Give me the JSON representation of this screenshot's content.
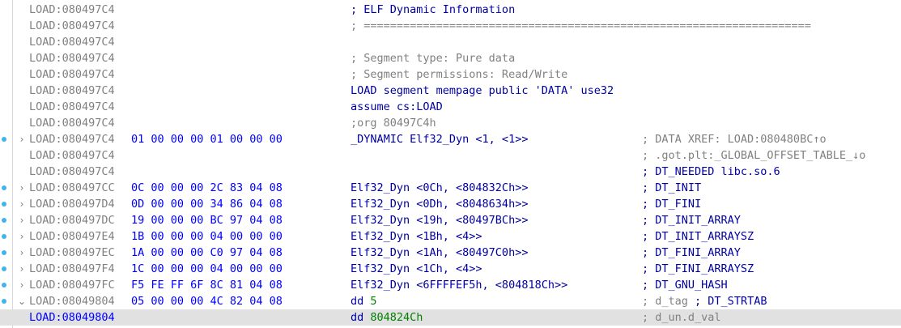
{
  "lines": [
    {
      "addr": "LOAD:080497C4",
      "bytes": "",
      "instr": "; ELF Dynamic Information",
      "instr_style": "blue",
      "comment": "",
      "comment_style": "blue",
      "fold": "",
      "bp": false
    },
    {
      "addr": "LOAD:080497C4",
      "bytes": "",
      "instr": "; ====================================================================",
      "instr_style": "gray",
      "comment": "",
      "comment_style": "blue",
      "fold": "",
      "bp": false
    },
    {
      "addr": "LOAD:080497C4",
      "bytes": "",
      "instr": "",
      "instr_style": "blue",
      "comment": "",
      "comment_style": "blue",
      "fold": "",
      "bp": false
    },
    {
      "addr": "LOAD:080497C4",
      "bytes": "",
      "instr": "; Segment type: Pure data",
      "instr_style": "gray",
      "comment": "",
      "comment_style": "blue",
      "fold": "",
      "bp": false
    },
    {
      "addr": "LOAD:080497C4",
      "bytes": "",
      "instr": "; Segment permissions: Read/Write",
      "instr_style": "gray",
      "comment": "",
      "comment_style": "blue",
      "fold": "",
      "bp": false
    },
    {
      "addr": "LOAD:080497C4",
      "bytes": "",
      "instr": "LOAD segment mempage public 'DATA' use32",
      "instr_style": "blue",
      "comment": "",
      "comment_style": "blue",
      "fold": "",
      "bp": false
    },
    {
      "addr": "LOAD:080497C4",
      "bytes": "",
      "instr": "assume cs:LOAD",
      "instr_style": "blue",
      "comment": "",
      "comment_style": "blue",
      "fold": "",
      "bp": false
    },
    {
      "addr": "LOAD:080497C4",
      "bytes": "",
      "instr": ";org 80497C4h",
      "instr_style": "gray",
      "comment": "",
      "comment_style": "blue",
      "fold": "",
      "bp": false
    },
    {
      "addr": "LOAD:080497C4",
      "bytes": "01 00 00 00 01 00 00 00",
      "instr": "_DYNAMIC Elf32_Dyn <1, <1>>",
      "instr_style": "blue",
      "comment": "; DATA XREF: LOAD:080480BC↑o",
      "comment_style": "gray",
      "fold": "›",
      "bp": true
    },
    {
      "addr": "LOAD:080497C4",
      "bytes": "",
      "instr": "",
      "instr_style": "blue",
      "comment": "; .got.plt:_GLOBAL_OFFSET_TABLE_↓o",
      "comment_style": "gray",
      "fold": "",
      "bp": false
    },
    {
      "addr": "LOAD:080497C4",
      "bytes": "",
      "instr": "",
      "instr_style": "blue",
      "comment": "; DT_NEEDED libc.so.6",
      "comment_style": "blue",
      "fold": "",
      "bp": false
    },
    {
      "addr": "LOAD:080497CC",
      "bytes": "0C 00 00 00 2C 83 04 08",
      "instr": "Elf32_Dyn <0Ch, <804832Ch>>",
      "instr_style": "blue",
      "comment": "; DT_INIT",
      "comment_style": "blue",
      "fold": "›",
      "bp": true
    },
    {
      "addr": "LOAD:080497D4",
      "bytes": "0D 00 00 00 34 86 04 08",
      "instr": "Elf32_Dyn <0Dh, <8048634h>>",
      "instr_style": "blue",
      "comment": "; DT_FINI",
      "comment_style": "blue",
      "fold": "›",
      "bp": true
    },
    {
      "addr": "LOAD:080497DC",
      "bytes": "19 00 00 00 BC 97 04 08",
      "instr": "Elf32_Dyn <19h, <80497BCh>>",
      "instr_style": "blue",
      "comment": "; DT_INIT_ARRAY",
      "comment_style": "blue",
      "fold": "›",
      "bp": true
    },
    {
      "addr": "LOAD:080497E4",
      "bytes": "1B 00 00 00 04 00 00 00",
      "instr": "Elf32_Dyn <1Bh, <4>>",
      "instr_style": "blue",
      "comment": "; DT_INIT_ARRAYSZ",
      "comment_style": "blue",
      "fold": "›",
      "bp": true
    },
    {
      "addr": "LOAD:080497EC",
      "bytes": "1A 00 00 00 C0 97 04 08",
      "instr": "Elf32_Dyn <1Ah, <80497C0h>>",
      "instr_style": "blue",
      "comment": "; DT_FINI_ARRAY",
      "comment_style": "blue",
      "fold": "›",
      "bp": true
    },
    {
      "addr": "LOAD:080497F4",
      "bytes": "1C 00 00 00 04 00 00 00",
      "instr": "Elf32_Dyn <1Ch, <4>>",
      "instr_style": "blue",
      "comment": "; DT_FINI_ARRAYSZ",
      "comment_style": "blue",
      "fold": "›",
      "bp": true
    },
    {
      "addr": "LOAD:080497FC",
      "bytes": "F5 FE FF 6F 8C 81 04 08",
      "instr": "Elf32_Dyn <6FFFFEF5h, <804818Ch>>",
      "instr_style": "blue",
      "comment": "; DT_GNU_HASH",
      "comment_style": "blue",
      "fold": "›",
      "bp": true
    },
    {
      "addr": "LOAD:08049804",
      "bytes": "05 00 00 00 4C 82 04 08",
      "instr_op": "dd",
      "instr_arg": "5",
      "instr_style": "blue",
      "comment_a": "; d_tag",
      "comment_b": "; DT_STRTAB",
      "comment_style": "blue",
      "fold": "⌄",
      "bp": true
    },
    {
      "addr": "LOAD:08049804",
      "bytes": "",
      "instr_op": "dd",
      "instr_arg": "804824Ch",
      "instr_style": "blue",
      "comment": "; d_un.d_val",
      "comment_style": "gray",
      "fold": "",
      "bp": false,
      "selected": true
    }
  ]
}
